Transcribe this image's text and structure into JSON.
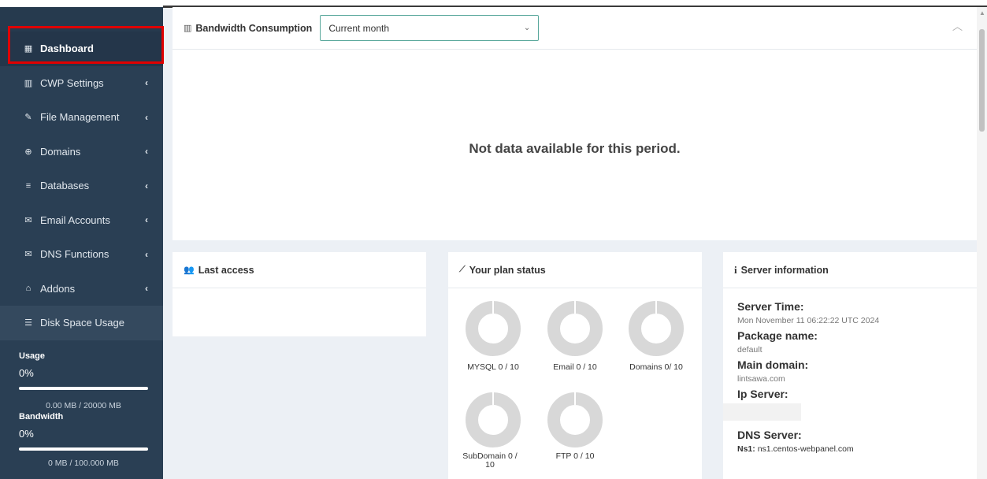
{
  "sidebar": {
    "items": [
      {
        "label": "Dashboard",
        "icon": "dashboard-icon",
        "chevron": ""
      },
      {
        "label": "CWP Settings",
        "icon": "bar-chart-icon",
        "chevron": "‹"
      },
      {
        "label": "File Management",
        "icon": "edit-icon",
        "chevron": "‹"
      },
      {
        "label": "Domains",
        "icon": "globe-icon",
        "chevron": "‹"
      },
      {
        "label": "Databases",
        "icon": "database-icon",
        "chevron": "‹"
      },
      {
        "label": "Email Accounts",
        "icon": "envelope-icon",
        "chevron": "‹"
      },
      {
        "label": "DNS Functions",
        "icon": "envelope-icon",
        "chevron": "‹"
      },
      {
        "label": "Addons",
        "icon": "institution-icon",
        "chevron": "‹"
      },
      {
        "label": "Disk Space Usage",
        "icon": "list-icon",
        "chevron": ""
      }
    ],
    "usage": {
      "label": "Usage",
      "percent": "0%",
      "amount": "0.00 MB / 20000 MB"
    },
    "bandwidth": {
      "label": "Bandwidth",
      "percent": "0%",
      "amount": "0 MB / 100.000 MB"
    }
  },
  "bandwidth_panel": {
    "title": "Bandwidth Consumption",
    "select_value": "Current month",
    "empty_message": "Not data available for this period."
  },
  "last_access": {
    "title": "Last access"
  },
  "plan_status": {
    "title": "Your plan status",
    "items": [
      {
        "label": "MYSQL 0 / 10"
      },
      {
        "label": "Email 0 / 10"
      },
      {
        "label": "Domains 0/ 10"
      },
      {
        "label": "SubDomain 0 / 10"
      },
      {
        "label": "FTP 0 / 10"
      }
    ]
  },
  "server_info": {
    "title": "Server information",
    "server_time_label": "Server Time:",
    "server_time": "Mon November 11 06:22:22 UTC 2024",
    "package_label": "Package name:",
    "package": "default",
    "main_domain_label": "Main domain:",
    "main_domain": "lintsawa.com",
    "ip_label": "Ip Server:",
    "dns_label": "DNS Server:",
    "ns1_label": "Ns1:",
    "ns1": "ns1.centos-webpanel.com"
  },
  "colors": {
    "sidebar_bg": "#2a3f54",
    "accent": "#5aa89c",
    "highlight_outline": "#e00000"
  }
}
